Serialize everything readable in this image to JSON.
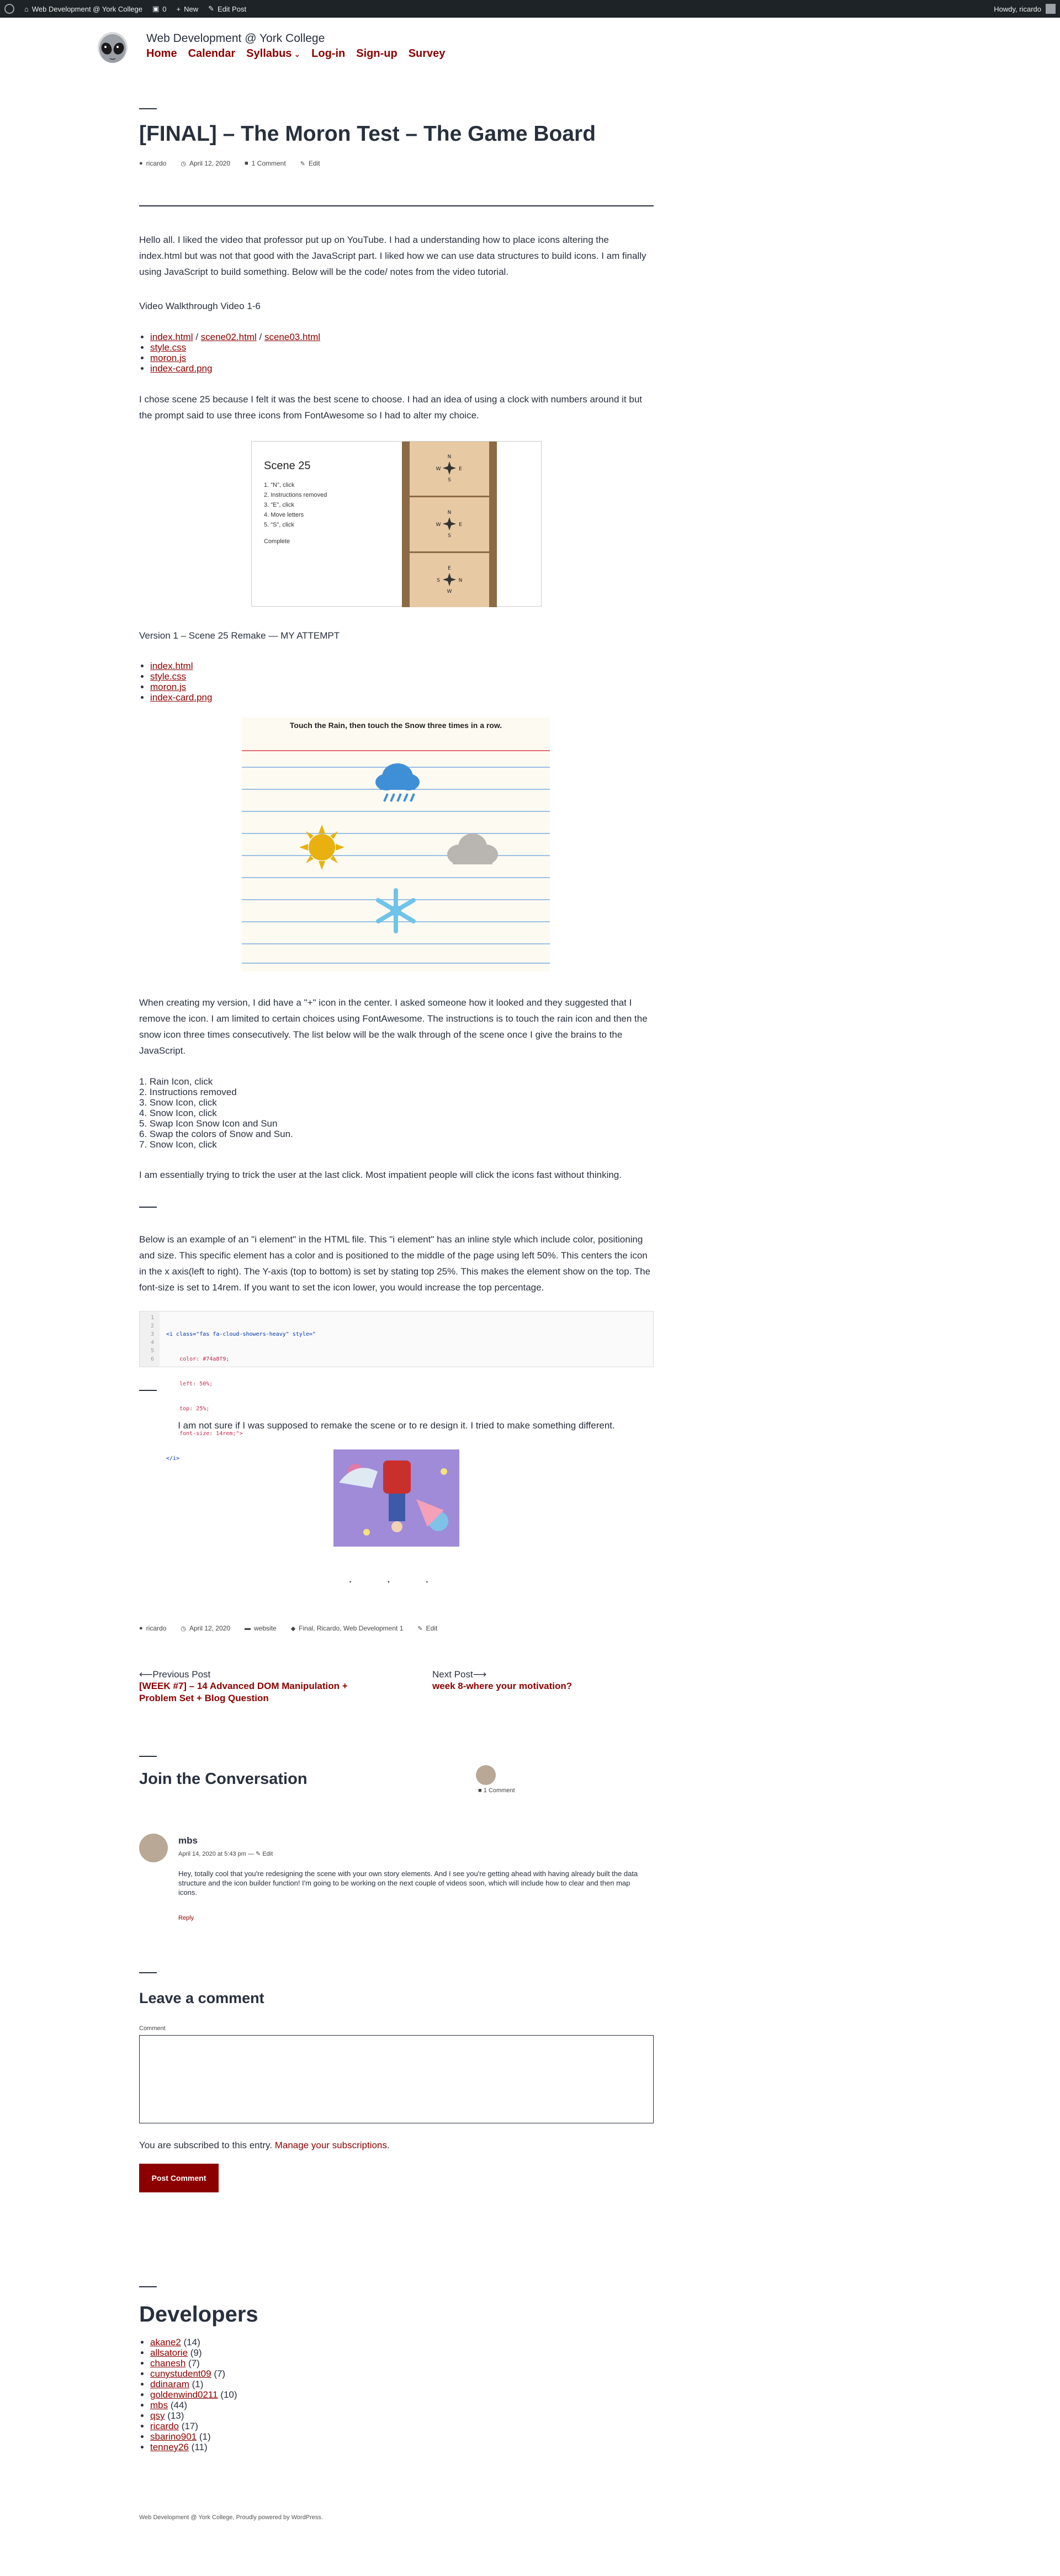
{
  "adminbar": {
    "site": "Web Development @ York College",
    "comments": "0",
    "new": "New",
    "edit": "Edit Post",
    "howdy": "Howdy, ricardo"
  },
  "header": {
    "site_title": "Web Development @ York College",
    "nav": [
      "Home",
      "Calendar",
      "Syllabus",
      "Log-in",
      "Sign-up",
      "Survey"
    ]
  },
  "post": {
    "title": "[FINAL] – The Moron Test – The Game Board",
    "meta": {
      "author": "ricardo",
      "date": "April 12, 2020",
      "comments": "1 Comment",
      "edit": "Edit"
    },
    "intro": "Hello all. I liked the video that professor put up on YouTube. I had a understanding how to place icons altering the index.html but was not that good with the JavaScript part. I liked how we can use data structures to build icons. I am finally using JavaScript to build something. Below will be the code/ notes from the video tutorial.",
    "walkthrough": "Video Walkthrough Video 1-6",
    "links1": {
      "index": "index.html",
      "scene02": "scene02.html",
      "scene03": "scene03.html",
      "style": "style.css",
      "moron": "moron.js",
      "card": "index-card.png"
    },
    "choice": "I chose scene 25 because I felt it was the best scene to choose. I had an idea of using a clock with numbers around it but the prompt said to use three icons from FontAwesome so I had to alter my choice.",
    "scene_card": {
      "title": "Scene 25",
      "steps": [
        "1.   \"N\", click",
        "2.   Instructions removed",
        "3.   \"E\", click",
        "4.   Move letters",
        "5.   \"S\", click"
      ],
      "complete": "Complete"
    },
    "version": "Version 1 – Scene 25 Remake — MY ATTEMPT",
    "links2": {
      "index": "index.html",
      "style": "style.css",
      "moron": "moron.js",
      "card": "index-card.png"
    },
    "rain_header": "Touch the Rain, then touch the Snow three times in a row.",
    "creating": "When creating my version, I did have a \"+\" icon in the center. I asked someone how it looked and they suggested that I remove the icon. I am limited to certain choices using FontAwesome. The instructions is to touch the rain icon and then the snow icon three times consecutively. The list below will be the walk through of the scene once I give the brains to the JavaScript.",
    "steps": [
      "1. Rain Icon, click",
      "2. Instructions removed",
      "3. Snow Icon, click",
      "4. Snow Icon, click",
      "5. Swap Icon Snow Icon and Sun",
      "6. Swap the colors of Snow and Sun.",
      "7. Snow Icon, click"
    ],
    "trick": "I am essentially trying to trick the user at the last click. Most impatient people will click the icons fast without thinking.",
    "below": "Below is an example of an \"i element\" in the HTML file. This \"i element\" has an inline style which include color, positioning and size. This specific element has a color and is positioned to the middle of the page using left 50%. This centers the icon in the x axis(left to right). The Y-axis (top to bottom) is set by stating top 25%. This makes the element show on the top. The font-size is set to 14rem. If you want to set the icon lower, you would increase the top percentage.",
    "code_lines": [
      "<i class=\"fas fa-cloud-showers-heavy\" style=\"",
      "    color: #74a8f9;",
      "    left: 50%;",
      "    top: 25%;",
      "    font-size: 14rem;\">",
      "</i>"
    ],
    "code_nums": [
      "1",
      "2",
      "3",
      "4",
      "5",
      "6"
    ],
    "unsure": "I am not sure if I was supposed to remake the scene or to re design it. I tried to make something different.",
    "dots": "· · ·",
    "footer_meta": {
      "author": "ricardo",
      "date": "April 12, 2020",
      "category": "website",
      "tags": "Final, Ricardo, Web Development 1",
      "edit": "Edit"
    }
  },
  "post_nav": {
    "prev_label": "Previous Post",
    "prev_title": "[WEEK #7] – 14 Advanced DOM Manipulation + Problem Set + Blog Question",
    "next_label": "Next Post",
    "next_title": "week 8-where your motivation?"
  },
  "conversation": {
    "title": "Join the Conversation",
    "count": "1 Comment",
    "comment": {
      "author": "mbs",
      "date": "April 14, 2020 at 5:43 pm",
      "edit": "Edit",
      "text": "Hey, totally cool that you're redesigning the scene with your own story elements. And I see you're getting ahead with having already built the data structure and the icon builder function! I'm going to be working on the next couple of videos soon, which will include how to clear and then map icons.",
      "reply": "Reply"
    }
  },
  "leave": {
    "title": "Leave a comment",
    "label": "Comment",
    "subscribed": "You are subscribed to this entry.",
    "manage": "Manage your subscriptions",
    "submit": "Post Comment"
  },
  "developers": {
    "title": "Developers",
    "items": [
      {
        "name": "akane2",
        "count": " (14)"
      },
      {
        "name": "allsatorie",
        "count": " (9)"
      },
      {
        "name": "chanesh",
        "count": " (7)"
      },
      {
        "name": "cunystudent09",
        "count": " (7)"
      },
      {
        "name": "ddinaram",
        "count": " (1)"
      },
      {
        "name": "goldenwind0211",
        "count": " (10)"
      },
      {
        "name": "mbs",
        "count": " (44)"
      },
      {
        "name": "qsy",
        "count": " (13)"
      },
      {
        "name": "ricardo",
        "count": " (17)"
      },
      {
        "name": "sbarino901",
        "count": " (1)"
      },
      {
        "name": "tenney26",
        "count": " (11)"
      }
    ]
  },
  "footer": {
    "text": "Web Development @ York College, Proudly powered by WordPress."
  },
  "colors": {
    "accent": "#8b0000",
    "text": "#28303d",
    "adminbar": "#1d2327"
  }
}
